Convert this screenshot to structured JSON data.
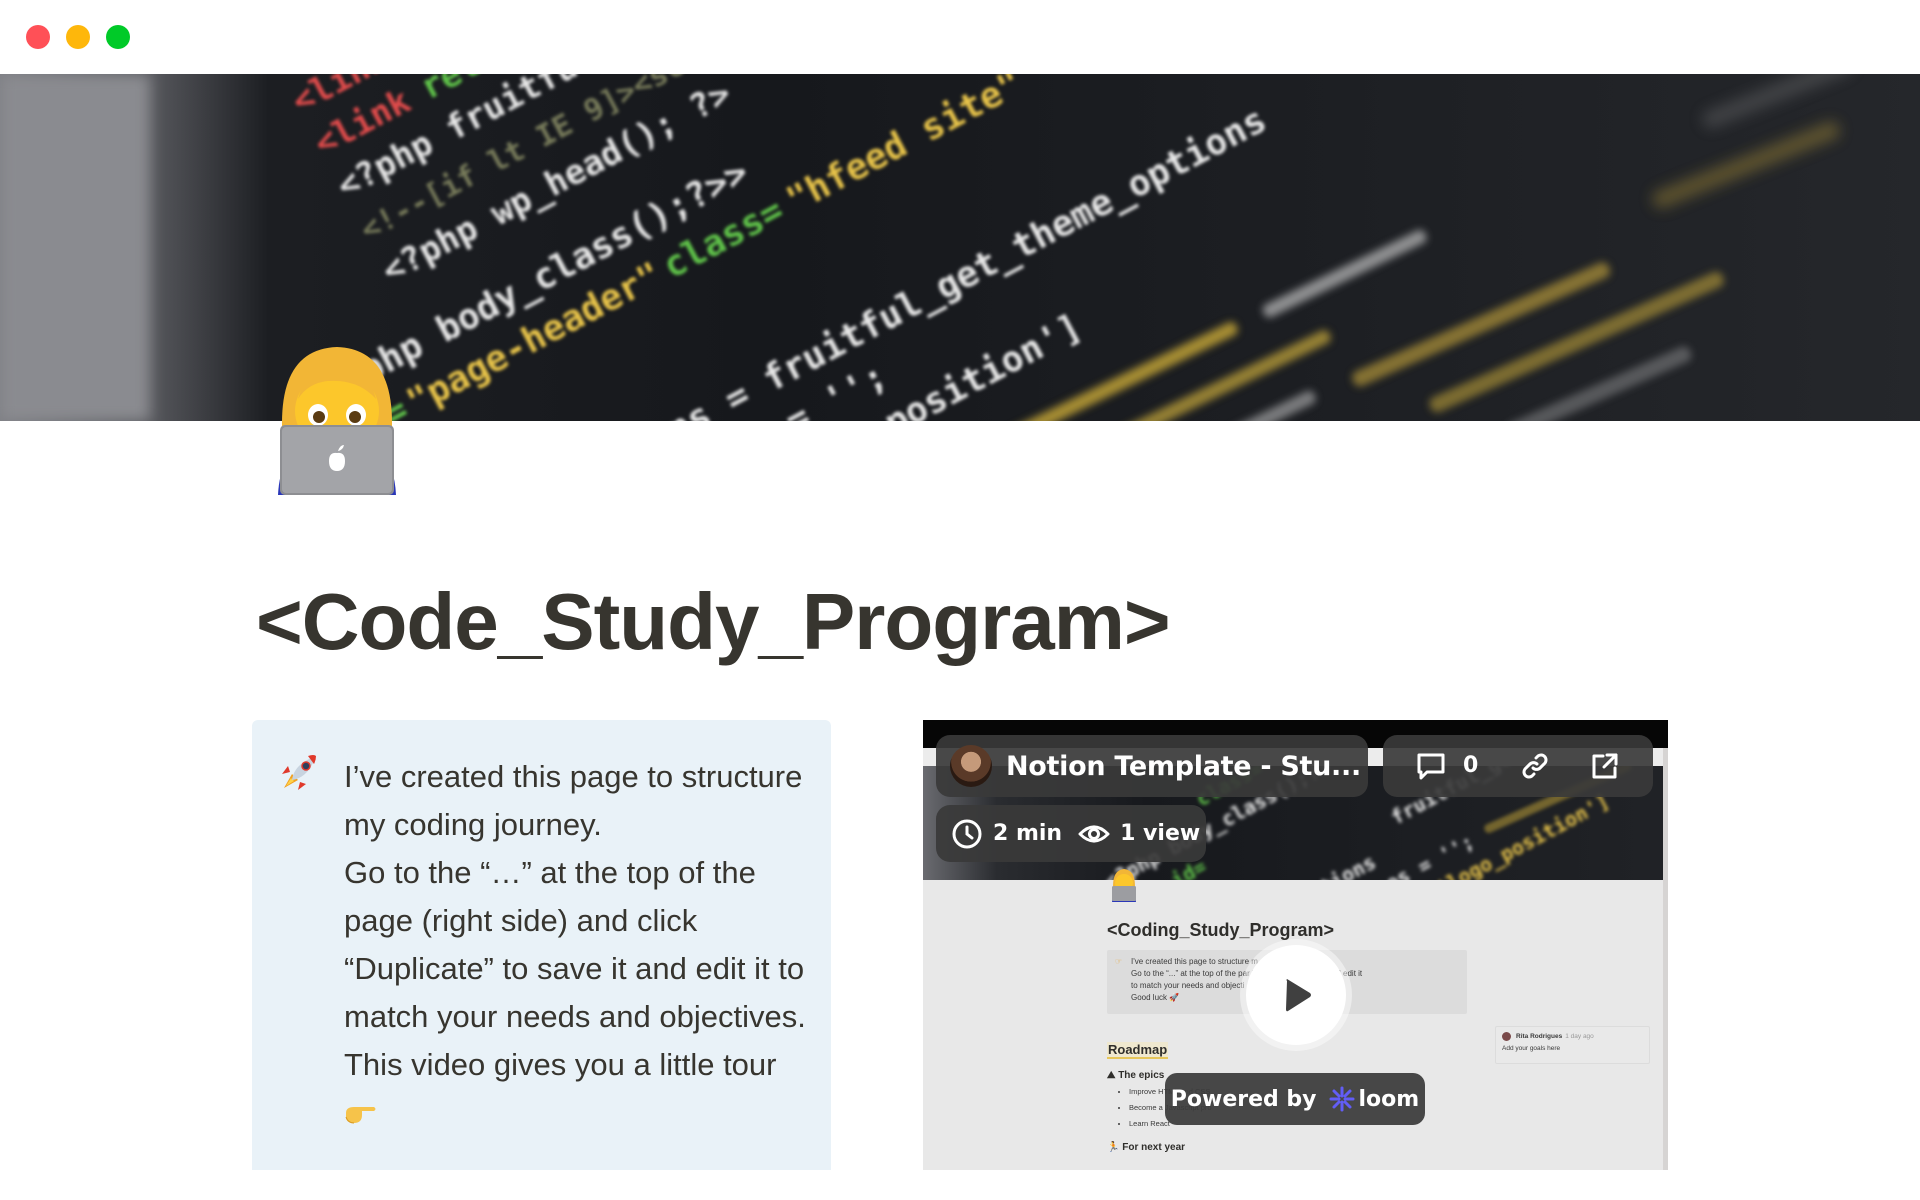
{
  "window": {
    "controls": [
      "close",
      "minimize",
      "maximize"
    ],
    "colors": {
      "close": "#ff5057",
      "minimize": "#feb70b",
      "maximize": "#00ca28"
    }
  },
  "page": {
    "cover_description": "Blurred photo of source code on a dark monitor",
    "icon": "woman-technologist-emoji",
    "title": "<Code_Study_Program>"
  },
  "callout": {
    "icon": "rocket-emoji",
    "background": "#e9f2f8",
    "paragraphs": [
      "I’ve created this page to structure my coding journey.",
      "Go to the “…” at the top of the page (right side) and click “Duplicate” to save it and edit it to match your needs and objectives.",
      "This video gives you a little tour"
    ],
    "trailing_icon": "backhand-pointing-right-emoji"
  },
  "video": {
    "provider": "loom",
    "title": "Notion Template - Stu...",
    "comment_count": "0",
    "duration": "2 min",
    "views": "1 view",
    "powered_by_label": "Powered by",
    "brand": "loom",
    "brand_color": "#625df5",
    "preview": {
      "title": "<Coding_Study_Program>",
      "callout_lines": [
        "I've created this page to structure m",
        "Go to the “...” at the top of the par                     \"Duplicate\" to save it and edit it",
        "to match your needs and objecti",
        "Good luck 🚀"
      ],
      "roadmap_heading": "Roadmap",
      "epics_heading": "The epics",
      "epics": [
        "Improve HTML and CSS",
        "Become a Javascript pro",
        "Learn React"
      ],
      "next_year_heading": "For next year",
      "comment": {
        "author": "Rita Rodrigues",
        "time": "1 day ago",
        "text": "Add your goals here"
      }
    }
  }
}
